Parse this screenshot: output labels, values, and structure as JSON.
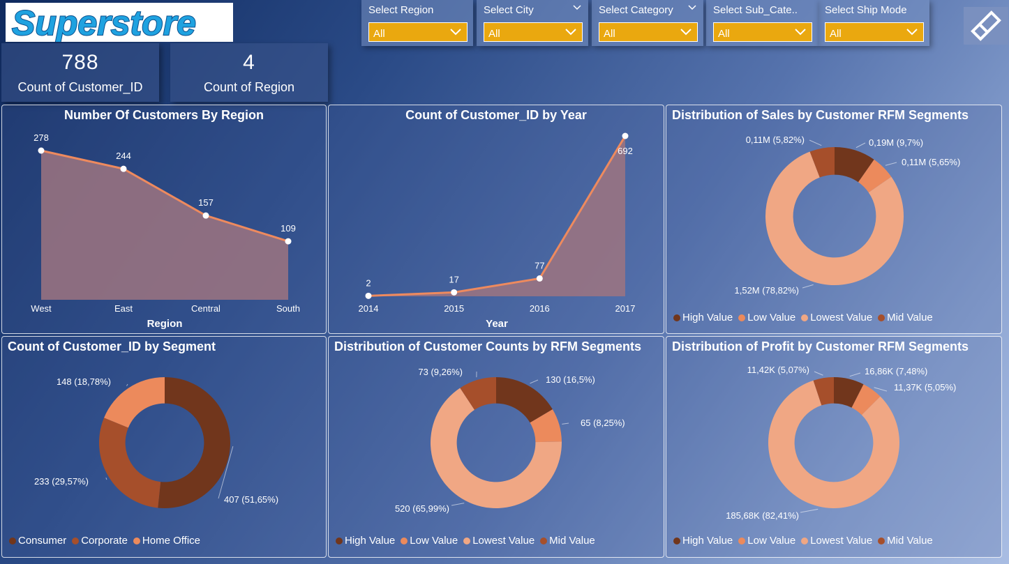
{
  "logo": {
    "text": "Superstore"
  },
  "kpis": [
    {
      "value": "788",
      "label": "Count of Customer_ID"
    },
    {
      "value": "4",
      "label": "Count of Region"
    }
  ],
  "slicers": [
    {
      "title": "Select Region",
      "value": "All"
    },
    {
      "title": "Select City",
      "value": "All"
    },
    {
      "title": "Select Category",
      "value": "All"
    },
    {
      "title": "Select Sub_Cate...",
      "value": "All"
    },
    {
      "title": "Select Ship Mode",
      "value": "All"
    }
  ],
  "colors": {
    "high": "#71361c",
    "low": "#ec8a5c",
    "lowest": "#f0a784",
    "mid": "#a64f2b",
    "consumer": "#71361c",
    "corporate": "#a64f2b",
    "home_office": "#ec8a5c",
    "line": "#ee8a5e",
    "area": "#9e7480",
    "slicer": "#eaa80f"
  },
  "chart_data": [
    {
      "type": "area",
      "title": "Number Of Customers By Region",
      "xlabel": "Region",
      "categories": [
        "West",
        "East",
        "Central",
        "South"
      ],
      "values": [
        278,
        244,
        157,
        109
      ],
      "labels": [
        "278",
        "244",
        "157",
        "109"
      ]
    },
    {
      "type": "area",
      "title": "Count of Customer_ID by Year",
      "xlabel": "Year",
      "categories": [
        "2014",
        "2015",
        "2016",
        "2017"
      ],
      "values": [
        2,
        17,
        77,
        692
      ],
      "labels": [
        "2",
        "17",
        "77",
        "692"
      ]
    },
    {
      "type": "pie",
      "title": "Distribution of Sales by Customer RFM Segments",
      "legend": [
        "High Value",
        "Low Value",
        "Lowest Value",
        "Mid Value"
      ],
      "slices": [
        {
          "name": "High Value",
          "value": 9.7,
          "label": "0,19M (9,7%)"
        },
        {
          "name": "Low Value",
          "value": 5.65,
          "label": "0,11M (5,65%)"
        },
        {
          "name": "Lowest Value",
          "value": 78.82,
          "label": "1,52M (78,82%)"
        },
        {
          "name": "Mid Value",
          "value": 5.82,
          "label": "0,11M (5,82%)"
        }
      ]
    },
    {
      "type": "pie",
      "title": "Count of Customer_ID by Segment",
      "legend": [
        "Consumer",
        "Corporate",
        "Home Office"
      ],
      "slices": [
        {
          "name": "Consumer",
          "value": 407,
          "label": "407 (51,65%)"
        },
        {
          "name": "Corporate",
          "value": 233,
          "label": "233 (29,57%)"
        },
        {
          "name": "Home Office",
          "value": 148,
          "label": "148 (18,78%)"
        }
      ]
    },
    {
      "type": "pie",
      "title": "Distribution of Customer Counts by RFM Segments",
      "legend": [
        "High Value",
        "Low Value",
        "Lowest Value",
        "Mid Value"
      ],
      "slices": [
        {
          "name": "High Value",
          "value": 130,
          "label": "130 (16,5%)"
        },
        {
          "name": "Low Value",
          "value": 65,
          "label": "65 (8,25%)"
        },
        {
          "name": "Lowest Value",
          "value": 520,
          "label": "520 (65,99%)"
        },
        {
          "name": "Mid Value",
          "value": 73,
          "label": "73 (9,26%)"
        }
      ]
    },
    {
      "type": "pie",
      "title": "Distribution of Profit by Customer RFM Segments",
      "legend": [
        "High Value",
        "Low Value",
        "Lowest Value",
        "Mid Value"
      ],
      "slices": [
        {
          "name": "High Value",
          "value": 7.48,
          "label": "16,86K (7,48%)"
        },
        {
          "name": "Low Value",
          "value": 5.05,
          "label": "11,37K (5,05%)"
        },
        {
          "name": "Lowest Value",
          "value": 82.41,
          "label": "185,68K (82,41%)"
        },
        {
          "name": "Mid Value",
          "value": 5.07,
          "label": "11,42K (5,07%)"
        }
      ]
    }
  ]
}
